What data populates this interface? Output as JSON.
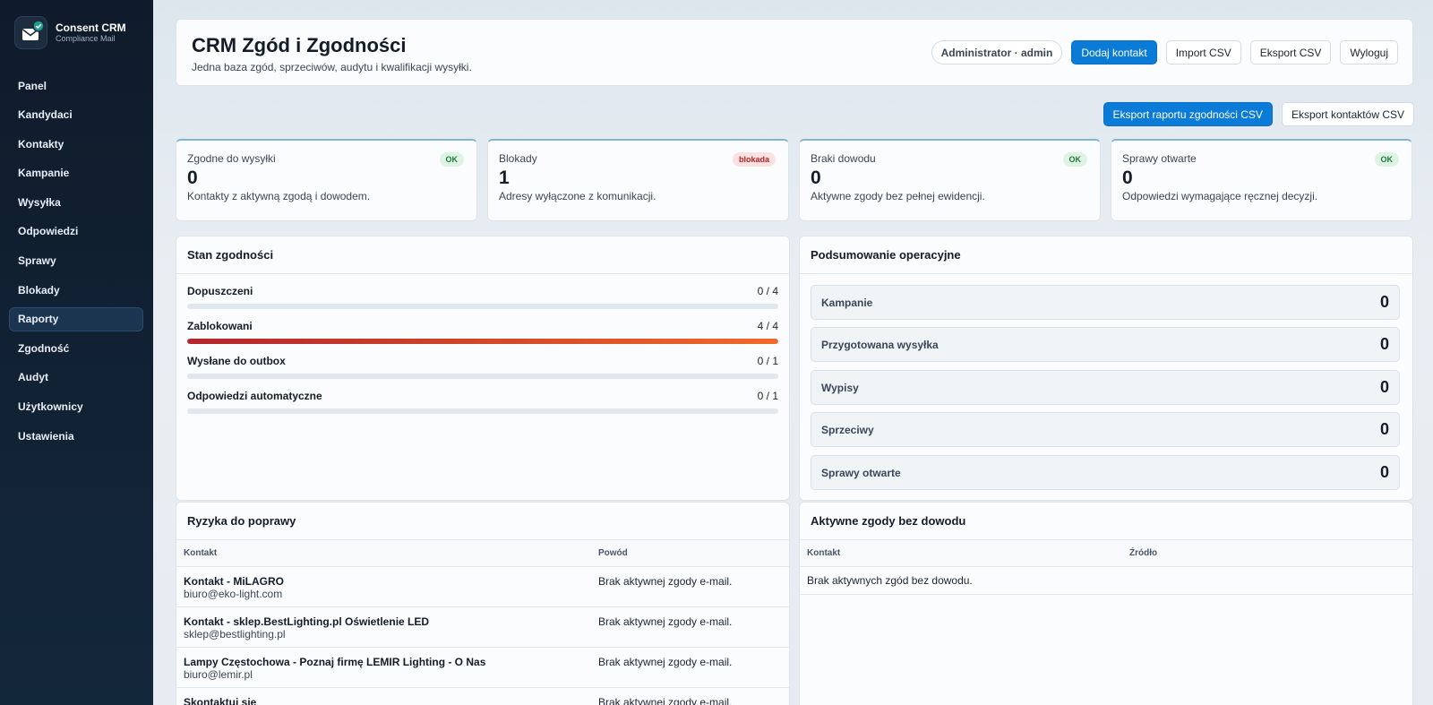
{
  "brand": {
    "name": "Consent CRM",
    "subtitle": "Compliance Mail",
    "logo_icon": "mail-check-icon"
  },
  "nav": [
    {
      "label": "Panel",
      "active": false
    },
    {
      "label": "Kandydaci",
      "active": false
    },
    {
      "label": "Kontakty",
      "active": false
    },
    {
      "label": "Kampanie",
      "active": false
    },
    {
      "label": "Wysyłka",
      "active": false
    },
    {
      "label": "Odpowiedzi",
      "active": false
    },
    {
      "label": "Sprawy",
      "active": false
    },
    {
      "label": "Blokady",
      "active": false
    },
    {
      "label": "Raporty",
      "active": true
    },
    {
      "label": "Zgodność",
      "active": false
    },
    {
      "label": "Audyt",
      "active": false
    },
    {
      "label": "Użytkownicy",
      "active": false
    },
    {
      "label": "Ustawienia",
      "active": false
    }
  ],
  "header": {
    "title": "CRM Zgód i Zgodności",
    "subtitle": "Jedna baza zgód, sprzeciwów, audytu i kwalifikacji wysyłki.",
    "user_label": "Administrator · admin",
    "add_contact": "Dodaj kontakt",
    "import_csv": "Import CSV",
    "export_csv": "Eksport CSV",
    "logout": "Wyloguj"
  },
  "exports": {
    "compliance_report": "Eksport raportu zgodności CSV",
    "contacts": "Eksport kontaktów CSV"
  },
  "stats": [
    {
      "label": "Zgodne do wysyłki",
      "value": "0",
      "desc": "Kontakty z aktywną zgodą i dowodem.",
      "badge": "OK",
      "badge_type": "ok"
    },
    {
      "label": "Blokady",
      "value": "1",
      "desc": "Adresy wyłączone z komunikacji.",
      "badge": "blokada",
      "badge_type": "block"
    },
    {
      "label": "Braki dowodu",
      "value": "0",
      "desc": "Aktywne zgody bez pełnej ewidencji.",
      "badge": "OK",
      "badge_type": "ok"
    },
    {
      "label": "Sprawy otwarte",
      "value": "0",
      "desc": "Odpowiedzi wymagające ręcznej decyzji.",
      "badge": "OK",
      "badge_type": "ok"
    }
  ],
  "compliance": {
    "title": "Stan zgodności",
    "metrics": [
      {
        "name": "Dopuszczeni",
        "count": "0 / 4",
        "fraction": 0
      },
      {
        "name": "Zablokowani",
        "count": "4 / 4",
        "fraction": 1
      },
      {
        "name": "Wysłane do outbox",
        "count": "0 / 1",
        "fraction": 0
      },
      {
        "name": "Odpowiedzi automatyczne",
        "count": "0 / 1",
        "fraction": 0
      }
    ]
  },
  "ops": {
    "title": "Podsumowanie operacyjne",
    "rows": [
      {
        "name": "Kampanie",
        "value": "0"
      },
      {
        "name": "Przygotowana wysyłka",
        "value": "0"
      },
      {
        "name": "Wypisy",
        "value": "0"
      },
      {
        "name": "Sprzeciwy",
        "value": "0"
      },
      {
        "name": "Sprawy otwarte",
        "value": "0"
      }
    ]
  },
  "risks": {
    "title": "Ryzyka do poprawy",
    "col_contact": "Kontakt",
    "col_reason": "Powód",
    "rows": [
      {
        "name": "Kontakt - MiLAGRO",
        "email": "biuro@eko-light.com",
        "reason": "Brak aktywnej zgody e-mail."
      },
      {
        "name": "Kontakt - sklep.BestLighting.pl Oświetlenie LED",
        "email": "sklep@bestlighting.pl",
        "reason": "Brak aktywnej zgody e-mail."
      },
      {
        "name": "Lampy Częstochowa - Poznaj firmę LEMIR Lighting - O Nas",
        "email": "biuro@lemir.pl",
        "reason": "Brak aktywnej zgody e-mail."
      },
      {
        "name": "Skontaktuj się",
        "email": "",
        "reason": "Brak aktywnej zgody e-mail."
      }
    ]
  },
  "no_proof": {
    "title": "Aktywne zgody bez dowodu",
    "col_contact": "Kontakt",
    "col_source": "Źródło",
    "empty": "Brak aktywnych zgód bez dowodu."
  }
}
